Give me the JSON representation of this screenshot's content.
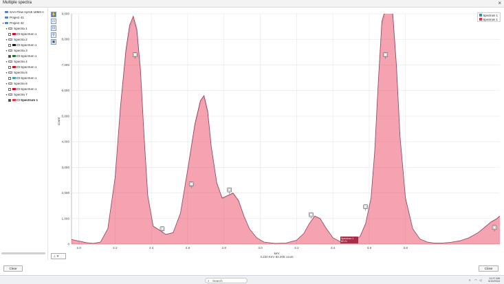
{
  "window": {
    "title": "Multiple spectra",
    "close_glyph": "×"
  },
  "tree": {
    "items": [
      {
        "type": "folder",
        "label": "SAA Flow Apr15 18M4 n",
        "indent": 0
      },
      {
        "type": "folder",
        "label": "Project 41",
        "indent": 0
      },
      {
        "type": "folder",
        "label": "Project 42",
        "indent": 0,
        "expanded": true
      },
      {
        "type": "spectra",
        "label": "Spectra 1",
        "indent": 1
      },
      {
        "type": "spectrum",
        "label": "Spectrum 1",
        "indent": 2,
        "checked": false,
        "color": "#c8102e"
      },
      {
        "type": "spectra",
        "label": "Spectra 2",
        "indent": 1
      },
      {
        "type": "spectrum",
        "label": "Spectrum 1",
        "indent": 2,
        "checked": false,
        "color": "#1a1a1a"
      },
      {
        "type": "spectra",
        "label": "Spectra 3",
        "indent": 1
      },
      {
        "type": "spectrum",
        "label": "Spectrum 1",
        "indent": 2,
        "checked": true,
        "color": "#2f6f3a"
      },
      {
        "type": "spectra",
        "label": "Spectra 4",
        "indent": 1
      },
      {
        "type": "spectrum",
        "label": "Spectrum 1",
        "indent": 2,
        "checked": false,
        "color": "#b3202c"
      },
      {
        "type": "spectra",
        "label": "Spectra 5",
        "indent": 1
      },
      {
        "type": "spectrum",
        "label": "Spectrum 1",
        "indent": 2,
        "checked": false,
        "color": "#4aa0a8"
      },
      {
        "type": "spectra",
        "label": "Spectra 6",
        "indent": 1
      },
      {
        "type": "spectrum",
        "label": "Spectrum 1",
        "indent": 2,
        "checked": false,
        "color": "#c8102e"
      },
      {
        "type": "spectra",
        "label": "Spectra 7",
        "indent": 1
      },
      {
        "type": "spectrum",
        "label": "Spectrum 1",
        "indent": 2,
        "checked": true,
        "color": "#e8334f",
        "bold": true
      }
    ]
  },
  "toolbar_icons": [
    "hand-icon",
    "zoom-box-icon",
    "zoom-region-icon",
    "peak-marker-icon",
    "screenshot-icon"
  ],
  "chart_toolbar_label": "⊥ ▾",
  "legend": [
    {
      "name": "Spectrum 1",
      "color": "#3a8f9a"
    },
    {
      "name": "Spectrum 1",
      "color": "#e8334f"
    }
  ],
  "chart_data": {
    "type": "area",
    "xlabel": "keV",
    "ylabel": "count",
    "xlim": [
      1.96,
      4.32
    ],
    "ylim": [
      0,
      9000
    ],
    "x_ticks": [
      2.0,
      2.2,
      2.4,
      2.6,
      2.8,
      3.0,
      3.2,
      3.4,
      3.6,
      3.8
    ],
    "x_tick_labels": [
      "2.0",
      "2.2",
      "2.4",
      "2.6",
      "2.8",
      "3.0",
      "3.2",
      "3.4",
      "3.6",
      "3.8"
    ],
    "y_ticks": [
      0,
      1000,
      2000,
      3000,
      4000,
      5000,
      6000,
      7000,
      8000,
      9000
    ],
    "y_tick_labels": [
      "0",
      "1,000",
      "2,000",
      "3,000",
      "4,000",
      "5,000",
      "6,000",
      "7,000",
      "8,000",
      "9,000"
    ],
    "grid": true,
    "legend_position": "top-right",
    "series": [
      {
        "color": "#e8334f",
        "x": [
          1.96,
          2.0,
          2.04,
          2.08,
          2.12,
          2.16,
          2.2,
          2.23,
          2.26,
          2.28,
          2.3,
          2.32,
          2.34,
          2.36,
          2.38,
          2.41,
          2.45,
          2.48,
          2.52,
          2.56,
          2.6,
          2.64,
          2.67,
          2.69,
          2.71,
          2.73,
          2.76,
          2.79,
          2.82,
          2.85,
          2.88,
          2.91,
          2.94,
          2.98,
          3.02,
          3.08,
          3.14,
          3.2,
          3.24,
          3.27,
          3.3,
          3.33,
          3.36,
          3.4,
          3.45,
          3.5,
          3.55,
          3.58,
          3.61,
          3.63,
          3.65,
          3.67,
          3.69,
          3.71,
          3.73,
          3.75,
          3.77,
          3.8,
          3.84,
          3.88,
          3.92,
          3.96,
          4.0,
          4.05,
          4.1,
          4.15,
          4.2,
          4.24,
          4.27,
          4.3,
          4.32
        ],
        "y": [
          180,
          120,
          60,
          30,
          80,
          600,
          2600,
          5400,
          7600,
          8550,
          8900,
          8400,
          6800,
          4200,
          1900,
          700,
          520,
          380,
          450,
          1200,
          2900,
          4700,
          5600,
          5800,
          5200,
          3800,
          2400,
          1800,
          1900,
          2000,
          1700,
          1100,
          600,
          250,
          80,
          30,
          40,
          150,
          420,
          800,
          1100,
          1000,
          650,
          250,
          60,
          40,
          300,
          800,
          1800,
          3600,
          6300,
          8700,
          9200,
          9400,
          9000,
          7000,
          4200,
          1800,
          600,
          200,
          80,
          40,
          40,
          70,
          130,
          250,
          450,
          680,
          860,
          980,
          1100
        ]
      }
    ],
    "peak_markers": [
      {
        "x": 2.31,
        "y": 7400
      },
      {
        "x": 2.46,
        "y": 600
      },
      {
        "x": 2.62,
        "y": 2350
      },
      {
        "x": 2.83,
        "y": 2120
      },
      {
        "x": 3.28,
        "y": 1150
      },
      {
        "x": 3.58,
        "y": 1460
      },
      {
        "x": 3.69,
        "y": 7400
      },
      {
        "x": 4.29,
        "y": 650
      }
    ]
  },
  "tooltip": {
    "line1": "Spectrum 1",
    "line2": "82.21"
  },
  "status_line": "3.220 KeV  82.205 count",
  "buttons": {
    "clear": "Clear",
    "close": "Close"
  },
  "taskbar": {
    "search_placeholder": "Search",
    "time": "11:27 AM",
    "date": "5/19/2024",
    "icons": [
      "windows-start-icon",
      "file-explorer-icon",
      "teams-icon",
      "mail-icon",
      "edge-icon",
      "store-icon",
      "photos-icon",
      "app-icon"
    ],
    "icon_colors": [
      "#2f7de1",
      "#f2b84b",
      "#6264a7",
      "#0f6cbd",
      "#1b9de2",
      "#243a5e",
      "#1a8a4c",
      "#3f51b5"
    ]
  }
}
